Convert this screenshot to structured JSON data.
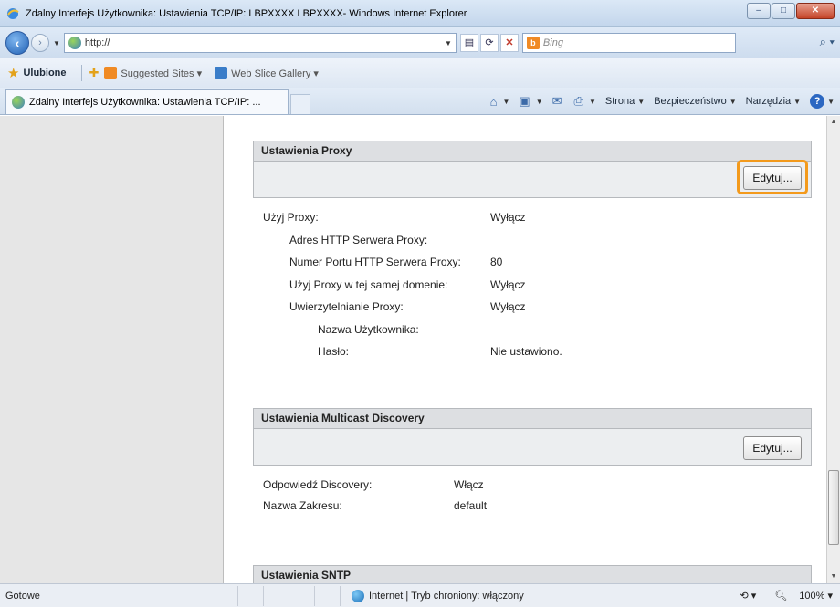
{
  "window": {
    "title": "Zdalny Interfejs Użytkownika: Ustawienia TCP/IP: LBPXXXX LBPXXXX- Windows Internet Explorer",
    "controls": {
      "minimize": "–",
      "maximize": "□",
      "close": "✕"
    }
  },
  "address_bar": {
    "url": "http://",
    "search_placeholder": "Bing"
  },
  "favorites_bar": {
    "favorites_label": "Ulubione",
    "items": [
      "Suggested Sites ▾",
      "Web Slice Gallery ▾"
    ]
  },
  "tab": {
    "title": "Zdalny Interfejs Użytkownika: Ustawienia TCP/IP: ..."
  },
  "command_bar": {
    "page_label": "Strona",
    "safety_label": "Bezpieczeństwo",
    "tools_label": "Narzędzia"
  },
  "sections": {
    "proxy": {
      "title": "Ustawienia Proxy",
      "edit_label": "Edytuj...",
      "rows": [
        {
          "label": "Użyj Proxy:",
          "value": "Wyłącz"
        },
        {
          "label": "Adres HTTP Serwera Proxy:",
          "value": ""
        },
        {
          "label": "Numer Portu HTTP Serwera Proxy:",
          "value": "80"
        },
        {
          "label": "Użyj Proxy w tej samej domenie:",
          "value": "Wyłącz"
        },
        {
          "label": "Uwierzytelnianie Proxy:",
          "value": "Wyłącz"
        },
        {
          "label": "Nazwa Użytkownika:",
          "value": ""
        },
        {
          "label": "Hasło:",
          "value": "Nie ustawiono."
        }
      ]
    },
    "multicast": {
      "title": "Ustawienia Multicast Discovery",
      "edit_label": "Edytuj...",
      "rows": [
        {
          "label": "Odpowiedź Discovery:",
          "value": "Włącz"
        },
        {
          "label": "Nazwa Zakresu:",
          "value": "default"
        }
      ]
    },
    "sntp": {
      "title": "Ustawienia SNTP"
    }
  },
  "status_bar": {
    "status": "Gotowe",
    "zone": "Internet | Tryb chroniony: włączony",
    "zoom": "100%"
  },
  "colors": {
    "highlight": "#f39a1c",
    "section_header": "#dddfe2",
    "left_pane": "#e6e6e6"
  }
}
